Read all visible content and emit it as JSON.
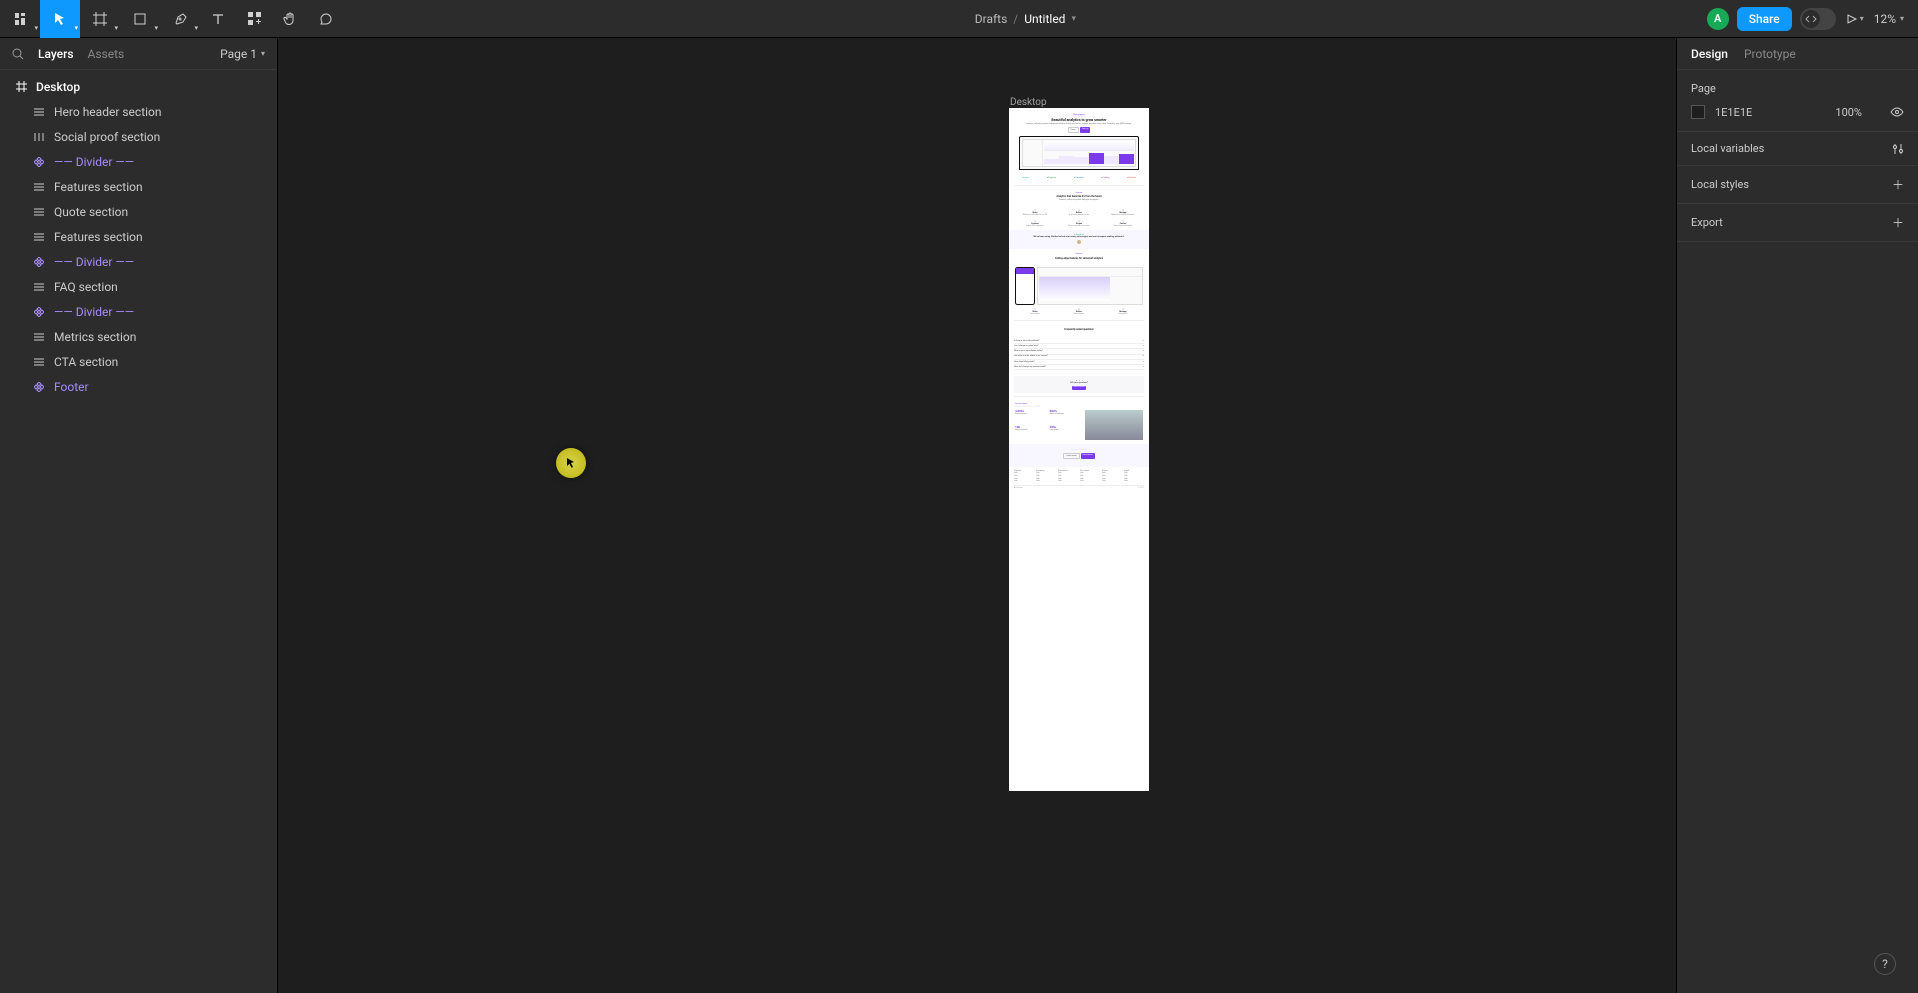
{
  "toolbar": {
    "drafts": "Drafts",
    "slash": "/",
    "filename": "Untitled",
    "share": "Share",
    "avatar": "A",
    "zoom": "12%"
  },
  "left": {
    "tab_layers": "Layers",
    "tab_assets": "Assets",
    "page_label": "Page 1",
    "root": "Desktop",
    "layers": [
      {
        "name": "Hero header section",
        "type": "frame"
      },
      {
        "name": "Social proof section",
        "type": "stack"
      },
      {
        "name": "—— Divider ——",
        "type": "component"
      },
      {
        "name": "Features section",
        "type": "frame"
      },
      {
        "name": "Quote section",
        "type": "frame"
      },
      {
        "name": "Features section",
        "type": "frame"
      },
      {
        "name": "—— Divider ——",
        "type": "component"
      },
      {
        "name": "FAQ section",
        "type": "frame"
      },
      {
        "name": "—— Divider ——",
        "type": "component"
      },
      {
        "name": "Metrics section",
        "type": "frame"
      },
      {
        "name": "CTA section",
        "type": "frame"
      },
      {
        "name": "Footer",
        "type": "component"
      }
    ]
  },
  "canvas": {
    "frame_label": "Desktop",
    "hero_pill": "New feature",
    "hero_h1": "Beautiful analytics to grow smarter",
    "hero_sub": "Powerful, self-serve product and growth analytics to help you convert, engage, and retain more users. Trusted by over 4,000 startups.",
    "btn_demo": "Demo",
    "btn_signup": "Sign up",
    "logos": [
      "Layers",
      "Sisyphus",
      "Circooles",
      "Catalog",
      "Quotient"
    ],
    "feat_tag": "Features",
    "feat_h": "Analytics that feels like it's from the future",
    "quote_brand": "Sisyphus",
    "quote": "We've been using Untitled to kick start every new project and can't imagine working without it.",
    "feat2_tag": "Features",
    "feat2_h": "Cutting-edge features for advanced analytics",
    "faq_h": "Frequently asked questions",
    "faq_items": [
      "Is there a free trial available?",
      "Can I change my plan later?",
      "What is your cancellation policy?",
      "Can other info be added to an invoice?",
      "How does billing work?",
      "How do I change my account email?"
    ],
    "still_q": "Still have questions?",
    "metrics_kicker": "Launch faster",
    "metrics_h": "Build something great",
    "metrics": [
      {
        "v": "4,000+",
        "l": "Global customers"
      },
      {
        "v": "600%",
        "l": "Return on investment"
      },
      {
        "v": "10k",
        "l": "Global downloads"
      },
      {
        "v": "200+",
        "l": "5-star reviews"
      }
    ],
    "cta_h": "Start your free trial",
    "foot_cols": [
      "Product",
      "Company",
      "Resources",
      "Use cases",
      "Social",
      "Legal"
    ]
  },
  "right": {
    "tab_design": "Design",
    "tab_prototype": "Prototype",
    "page_label": "Page",
    "page_color": "1E1E1E",
    "page_pct": "100%",
    "local_vars": "Local variables",
    "local_styles": "Local styles",
    "export": "Export"
  }
}
